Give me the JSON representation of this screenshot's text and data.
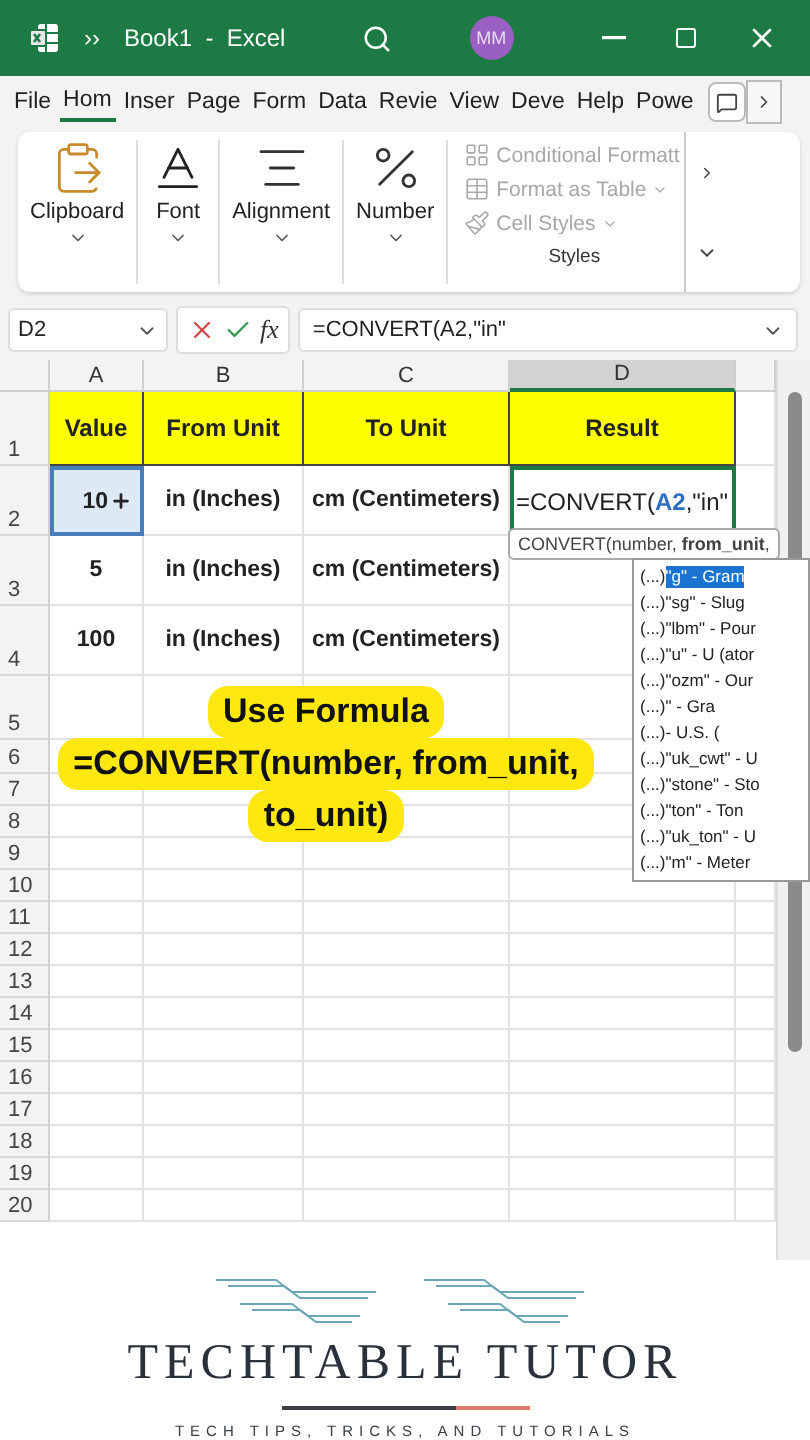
{
  "title_bar": {
    "overflow": "››",
    "title": "Book1  -  Excel",
    "avatar": "MM"
  },
  "ribbon_tabs": [
    {
      "label": "File",
      "selected": false
    },
    {
      "label": "Hom",
      "selected": true
    },
    {
      "label": "Inser",
      "selected": false
    },
    {
      "label": "Page",
      "selected": false
    },
    {
      "label": "Form",
      "selected": false
    },
    {
      "label": "Data",
      "selected": false
    },
    {
      "label": "Revie",
      "selected": false
    },
    {
      "label": "View",
      "selected": false
    },
    {
      "label": "Deve",
      "selected": false
    },
    {
      "label": "Help",
      "selected": false
    },
    {
      "label": "Powe",
      "selected": false
    }
  ],
  "ribbon": {
    "groups": [
      {
        "label": "Clipboard",
        "kind": "clipboard"
      },
      {
        "label": "Font",
        "kind": "font"
      },
      {
        "label": "Alignment",
        "kind": "alignment"
      },
      {
        "label": "Number",
        "kind": "number"
      }
    ],
    "styles": {
      "label": "Styles",
      "items": [
        {
          "label": "Conditional Formatt",
          "kind": "conditional",
          "disabled": true,
          "dropdown": false
        },
        {
          "label": "Format as Table",
          "kind": "table",
          "disabled": true,
          "dropdown": true
        },
        {
          "label": "Cell Styles",
          "kind": "cells",
          "disabled": true,
          "dropdown": true
        }
      ]
    }
  },
  "formula_bar": {
    "name_box": "D2",
    "fx": "fx",
    "formula": "=CONVERT(A2,\"in\""
  },
  "sheet": {
    "columns": [
      {
        "label": "A",
        "selected": false
      },
      {
        "label": "B",
        "selected": false
      },
      {
        "label": "C",
        "selected": false
      },
      {
        "label": "D",
        "selected": true
      }
    ],
    "rows": [
      {
        "label": "1",
        "cells": [
          {
            "text": "Value",
            "kind": "header"
          },
          {
            "text": "From Unit",
            "kind": "header"
          },
          {
            "text": "To Unit",
            "kind": "header"
          },
          {
            "text": "Result",
            "kind": "header"
          }
        ]
      },
      {
        "label": "2",
        "cells": [
          {
            "text": "10",
            "kind": "referenced"
          },
          {
            "text": "in (Inches)",
            "kind": "text"
          },
          {
            "text": "cm (Centimeters)",
            "kind": "text"
          },
          {
            "kind": "editing",
            "parts": [
              {
                "text": "=CONVERT(",
                "kind": "plain"
              },
              {
                "text": "A2",
                "kind": "ref"
              },
              {
                "text": ",\"in\"",
                "kind": "plain"
              }
            ]
          }
        ]
      },
      {
        "label": "3",
        "cells": [
          {
            "text": "5",
            "kind": "text"
          },
          {
            "text": "in (Inches)",
            "kind": "text"
          },
          {
            "text": "cm (Centimeters)",
            "kind": "text"
          }
        ]
      },
      {
        "label": "4",
        "cells": [
          {
            "text": "100",
            "kind": "text"
          },
          {
            "text": "in (Inches)",
            "kind": "text"
          },
          {
            "text": "cm (Centimeters)",
            "kind": "text"
          }
        ]
      },
      {
        "label": "5"
      },
      {
        "label": "6"
      },
      {
        "label": "7"
      },
      {
        "label": "8"
      },
      {
        "label": "9"
      },
      {
        "label": "10"
      },
      {
        "label": "11"
      },
      {
        "label": "12"
      },
      {
        "label": "13"
      },
      {
        "label": "14"
      },
      {
        "label": "15"
      },
      {
        "label": "16"
      },
      {
        "label": "17"
      },
      {
        "label": "18"
      },
      {
        "label": "19"
      },
      {
        "label": "20"
      }
    ]
  },
  "tooltip": "CONVERT(number, **from_unit**,",
  "autocomplete": [
    {
      "prefix": "(...)",
      "text": "\"g\" - Gram",
      "selected": true
    },
    {
      "prefix": "(...)",
      "text": "\"sg\" - Slug",
      "selected": false
    },
    {
      "prefix": "(...)",
      "text": "\"lbm\" - Pour",
      "selected": false
    },
    {
      "prefix": "(...)",
      "text": "\"u\" - U (ator",
      "selected": false
    },
    {
      "prefix": "(...)",
      "text": "\"ozm\" - Our",
      "selected": false
    },
    {
      "prefix": "(...)",
      "text": "\" - Gra",
      "selected": false
    },
    {
      "prefix": "(...)",
      "text": "- U.S. (",
      "selected": false
    },
    {
      "prefix": "(...)",
      "text": "\"uk_cwt\" - U",
      "selected": false
    },
    {
      "prefix": "(...)",
      "text": "\"stone\" - Sto",
      "selected": false
    },
    {
      "prefix": "(...)",
      "text": "\"ton\" - Ton",
      "selected": false
    },
    {
      "prefix": "(...)",
      "text": "\"uk_ton\" - U",
      "selected": false
    },
    {
      "prefix": "(...)",
      "text": "\"m\" - Meter",
      "selected": false
    }
  ],
  "callout": [
    "Use Formula",
    "=CONVERT(number, from_unit,",
    "to_unit)"
  ],
  "brand": {
    "name": "TECHTABLE TUTOR",
    "tagline": "TECH TIPS, TRICKS, AND TUTORIALS"
  }
}
